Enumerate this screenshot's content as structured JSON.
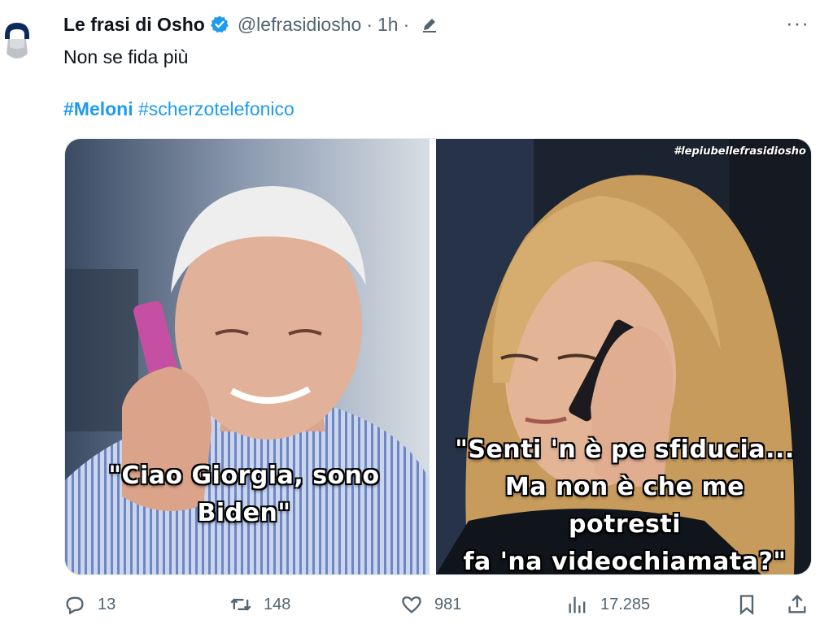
{
  "tweet": {
    "author_name": "Le frasi di Osho",
    "handle": "@lefrasidiosho",
    "dot": "·",
    "time": "1h",
    "dot2": "·",
    "text": "Non se fida più",
    "hashtags": [
      "#Meloni",
      "#scherzotelefonico"
    ],
    "more_label": "···"
  },
  "media": {
    "left_caption_line1": "\"Ciao Giorgia, sono",
    "left_caption_line2": "Biden\"",
    "right_caption_line1": "\"Senti 'n è pe sfiducia...",
    "right_caption_line2": "Ma non è che me potresti",
    "right_caption_line3": "fa 'na videochiamata?\"",
    "watermark": "#lepiubellefrasidiosho"
  },
  "actions": {
    "replies": "13",
    "reposts": "148",
    "likes": "981",
    "views": "17.285"
  },
  "colors": {
    "accent": "#1d9bf0",
    "muted": "#536471",
    "text": "#0f1419"
  }
}
